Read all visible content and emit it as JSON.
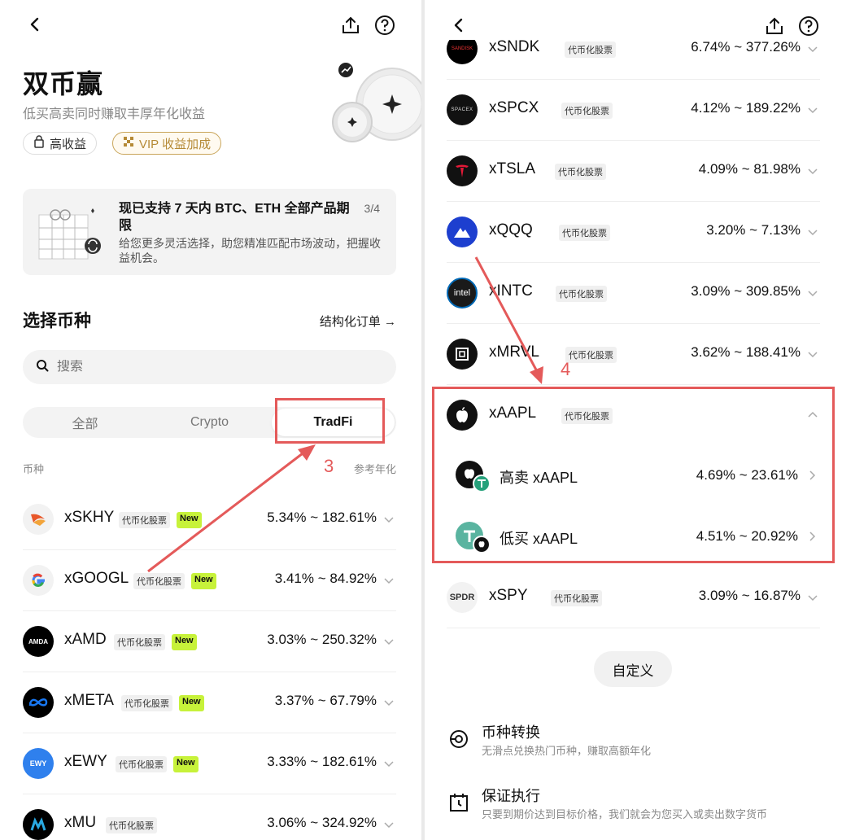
{
  "left": {
    "title": "双币赢",
    "subtitle": "低买高卖同时赚取丰厚年化收益",
    "tags": {
      "high_yield": "高收益",
      "vip": "VIP 收益加成"
    },
    "banner": {
      "title": "现已支持 7 天内 BTC、ETH 全部产品期限",
      "desc": "给您更多灵活选择，助您精准匹配市场波动，把握收益机会。",
      "page": "3/4"
    },
    "section_title": "选择币种",
    "section_link": "结构化订单 →",
    "search_placeholder": "搜索",
    "tabs": [
      "全部",
      "Crypto",
      "TradFi"
    ],
    "annotation": "3",
    "col_coin": "币种",
    "col_apr": "参考年化",
    "badge_label": "代币化股票",
    "new_label": "New",
    "rows": [
      {
        "sym": "xSKHY",
        "range": "5.34% ~ 182.61%",
        "new": true
      },
      {
        "sym": "xGOOGL",
        "range": "3.41% ~ 84.92%",
        "new": true
      },
      {
        "sym": "xAMD",
        "range": "3.03% ~ 250.32%",
        "new": true
      },
      {
        "sym": "xMETA",
        "range": "3.37% ~ 67.79%",
        "new": true
      },
      {
        "sym": "xEWY",
        "range": "3.33% ~ 182.61%",
        "new": true
      },
      {
        "sym": "xMU",
        "range": "3.06% ~ 324.92%",
        "new": false
      }
    ]
  },
  "right": {
    "annotation": "4",
    "badge_label": "代币化股票",
    "rows": [
      {
        "sym": "xSNDK",
        "range": "6.74% ~ 377.26%"
      },
      {
        "sym": "xSPCX",
        "range": "4.12% ~ 189.22%"
      },
      {
        "sym": "xTSLA",
        "range": "4.09% ~ 81.98%"
      },
      {
        "sym": "xQQQ",
        "range": "3.20% ~ 7.13%"
      },
      {
        "sym": "xINTC",
        "range": "3.09% ~ 309.85%"
      },
      {
        "sym": "xMRVL",
        "range": "3.62% ~ 188.41%"
      },
      {
        "sym": "xAAPL"
      },
      {
        "sym": "xSPY",
        "range": "3.09% ~ 16.87%"
      }
    ],
    "logo_text": {
      "amd": "AMDA",
      "spacex": "SPACEX",
      "intel": "intel",
      "spdr": "SPDR",
      "ewy": "EWY"
    },
    "sub_rows": [
      {
        "label": "高卖 xAAPL",
        "range": "4.69% ~ 23.61%"
      },
      {
        "label": "低买 xAAPL",
        "range": "4.51% ~ 20.92%"
      }
    ],
    "custom_button": "自定义",
    "features": [
      {
        "title": "币种转换",
        "desc": "无滑点兑换热门币种，赚取高额年化"
      },
      {
        "title": "保证执行",
        "desc": "只要到期价达到目标价格，我们就会为您买入或卖出数字货币"
      }
    ]
  },
  "colors": {
    "accent_red": "#e45a5a",
    "new_badge": "#c7f23a",
    "vip_gold": "#c9a55a"
  }
}
